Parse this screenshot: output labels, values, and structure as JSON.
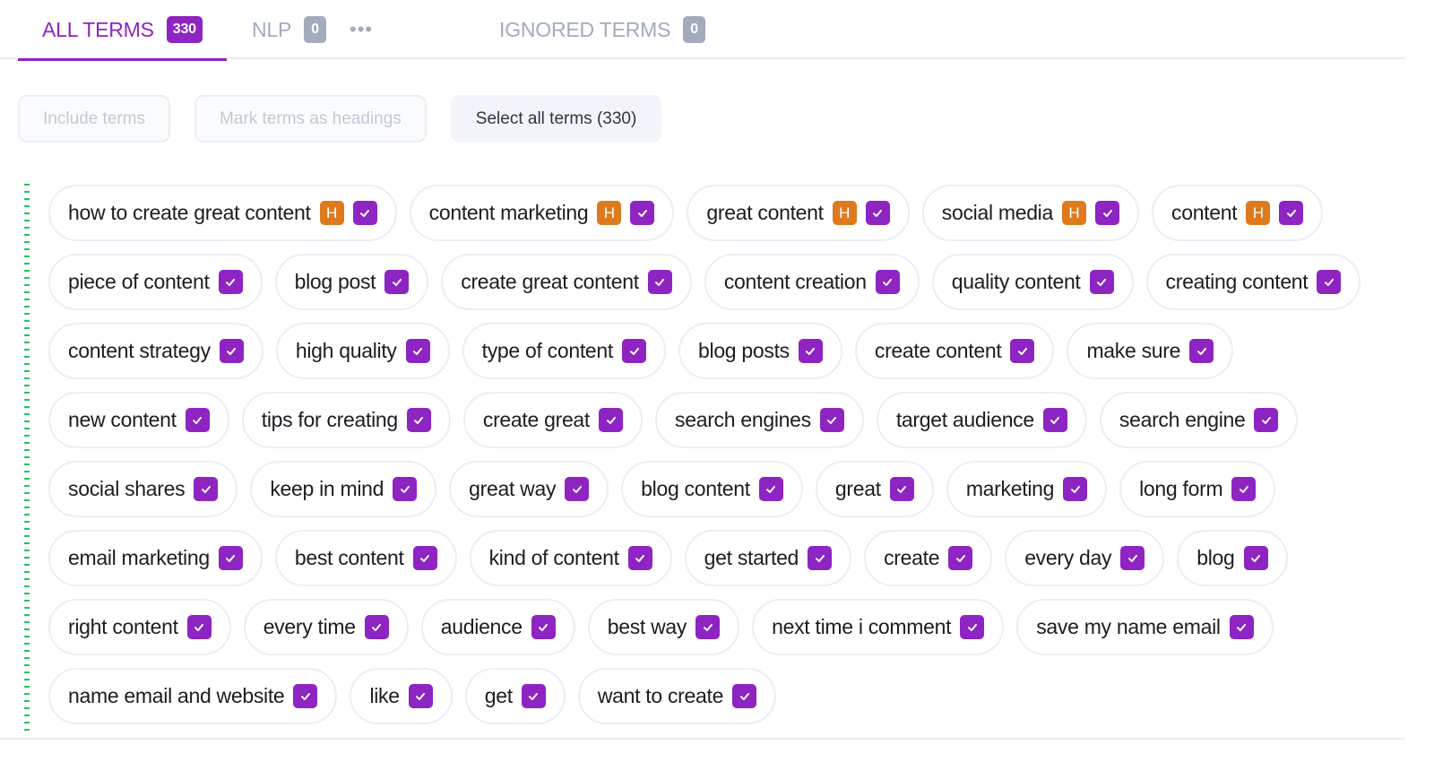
{
  "tabs": {
    "all": {
      "label": "ALL TERMS",
      "count": "330",
      "active": true
    },
    "nlp": {
      "label": "NLP",
      "count": "0"
    },
    "more_icon": "•••",
    "ignored": {
      "label": "IGNORED TERMS",
      "count": "0"
    }
  },
  "actions": {
    "include_terms": "Include terms",
    "mark_headings": "Mark terms as headings",
    "select_all": "Select all terms (330)"
  },
  "colors": {
    "accent": "#8e24c2",
    "heading_badge": "#de7a1e",
    "muted": "#a3abbd",
    "indicator_line": "#22c55e"
  },
  "heading_badge_label": "H",
  "terms": [
    {
      "text": "how to create great content",
      "heading": true,
      "checked": true
    },
    {
      "text": "content marketing",
      "heading": true,
      "checked": true
    },
    {
      "text": "great content",
      "heading": true,
      "checked": true
    },
    {
      "text": "social media",
      "heading": true,
      "checked": true
    },
    {
      "text": "content",
      "heading": true,
      "checked": true
    },
    {
      "text": "piece of content",
      "heading": false,
      "checked": true
    },
    {
      "text": "blog post",
      "heading": false,
      "checked": true
    },
    {
      "text": "create great content",
      "heading": false,
      "checked": true
    },
    {
      "text": "content creation",
      "heading": false,
      "checked": true
    },
    {
      "text": "quality content",
      "heading": false,
      "checked": true
    },
    {
      "text": "creating content",
      "heading": false,
      "checked": true
    },
    {
      "text": "content strategy",
      "heading": false,
      "checked": true
    },
    {
      "text": "high quality",
      "heading": false,
      "checked": true
    },
    {
      "text": "type of content",
      "heading": false,
      "checked": true
    },
    {
      "text": "blog posts",
      "heading": false,
      "checked": true
    },
    {
      "text": "create content",
      "heading": false,
      "checked": true
    },
    {
      "text": "make sure",
      "heading": false,
      "checked": true
    },
    {
      "text": "new content",
      "heading": false,
      "checked": true
    },
    {
      "text": "tips for creating",
      "heading": false,
      "checked": true
    },
    {
      "text": "create great",
      "heading": false,
      "checked": true
    },
    {
      "text": "search engines",
      "heading": false,
      "checked": true
    },
    {
      "text": "target audience",
      "heading": false,
      "checked": true
    },
    {
      "text": "search engine",
      "heading": false,
      "checked": true
    },
    {
      "text": "social shares",
      "heading": false,
      "checked": true
    },
    {
      "text": "keep in mind",
      "heading": false,
      "checked": true
    },
    {
      "text": "great way",
      "heading": false,
      "checked": true
    },
    {
      "text": "blog content",
      "heading": false,
      "checked": true
    },
    {
      "text": "great",
      "heading": false,
      "checked": true
    },
    {
      "text": "marketing",
      "heading": false,
      "checked": true
    },
    {
      "text": "long form",
      "heading": false,
      "checked": true
    },
    {
      "text": "email marketing",
      "heading": false,
      "checked": true
    },
    {
      "text": "best content",
      "heading": false,
      "checked": true
    },
    {
      "text": "kind of content",
      "heading": false,
      "checked": true
    },
    {
      "text": "get started",
      "heading": false,
      "checked": true
    },
    {
      "text": "create",
      "heading": false,
      "checked": true
    },
    {
      "text": "every day",
      "heading": false,
      "checked": true
    },
    {
      "text": "blog",
      "heading": false,
      "checked": true
    },
    {
      "text": "right content",
      "heading": false,
      "checked": true
    },
    {
      "text": "every time",
      "heading": false,
      "checked": true
    },
    {
      "text": "audience",
      "heading": false,
      "checked": true
    },
    {
      "text": "best way",
      "heading": false,
      "checked": true
    },
    {
      "text": "next time i comment",
      "heading": false,
      "checked": true
    },
    {
      "text": "save my name email",
      "heading": false,
      "checked": true
    },
    {
      "text": "name email and website",
      "heading": false,
      "checked": true
    },
    {
      "text": "like",
      "heading": false,
      "checked": true
    },
    {
      "text": "get",
      "heading": false,
      "checked": true
    },
    {
      "text": "want to create",
      "heading": false,
      "checked": true
    }
  ]
}
